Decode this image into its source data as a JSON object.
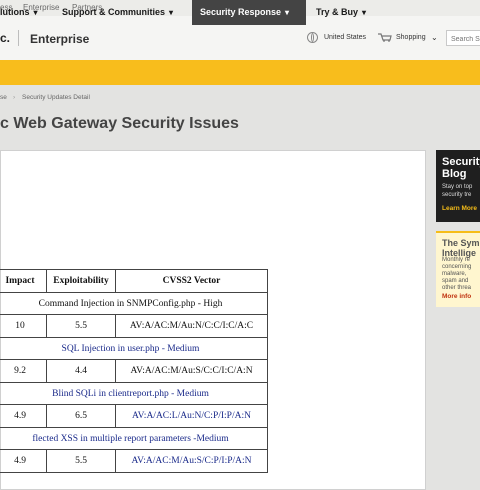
{
  "top_links": [
    "ess",
    "Enterprise",
    "Partners"
  ],
  "header": {
    "logo_fragment": "c.",
    "brand": "Enterprise",
    "country": "United States",
    "shopping": "Shopping",
    "search_placeholder": "Search S"
  },
  "nav": {
    "items": [
      {
        "label": "lutions"
      },
      {
        "label": "Support & Communities"
      },
      {
        "label": "Security Response"
      },
      {
        "label": "Try & Buy"
      }
    ]
  },
  "breadcrumb": [
    "se",
    "Security Updates Detail"
  ],
  "page_title": "c Web Gateway Security Issues",
  "table": {
    "headers": [
      "Impact",
      "Exploitability",
      "CVSS2 Vector"
    ],
    "groups": [
      {
        "title": "Command Injection in SNMPConfig.php - High",
        "impact": "10",
        "exploitability": "5.5",
        "vector": "AV:A/AC:M/Au:N/C:C/I:C/A:C"
      },
      {
        "title": "SQL Injection in user.php  - Medium",
        "impact": "9.2",
        "exploitability": "4.4",
        "vector": "AV:A/AC:M/Au:S/C:C/I:C/A:N"
      },
      {
        "title": "Blind SQLi in clientreport.php - Medium",
        "impact": "4.9",
        "exploitability": "6.5",
        "vector": "AV:A/AC:L/Au:N/C:P/I:P/A:N"
      },
      {
        "title": "flected XSS in multiple report parameters -Medium",
        "impact": "4.9",
        "exploitability": "5.5",
        "vector": "AV:A/AC:M/Au:S/C:P/I:P/A:N"
      }
    ]
  },
  "rail": {
    "blog_title_1": "Security",
    "blog_title_2": "Blog",
    "blog_sub_1": "Stay on top",
    "blog_sub_2": "security tre",
    "blog_link": "Learn More",
    "intel_title_1": "The Sym",
    "intel_title_2": "Intellige",
    "intel_lines": [
      "Monthly re",
      "concerning",
      "malware,",
      "spam and",
      "other threa"
    ],
    "intel_link": "More info"
  },
  "colors": {
    "nav": "#f8bd1c",
    "nav_active": "#444444",
    "title": "#444444",
    "link_navy": "#1a2a8a"
  }
}
